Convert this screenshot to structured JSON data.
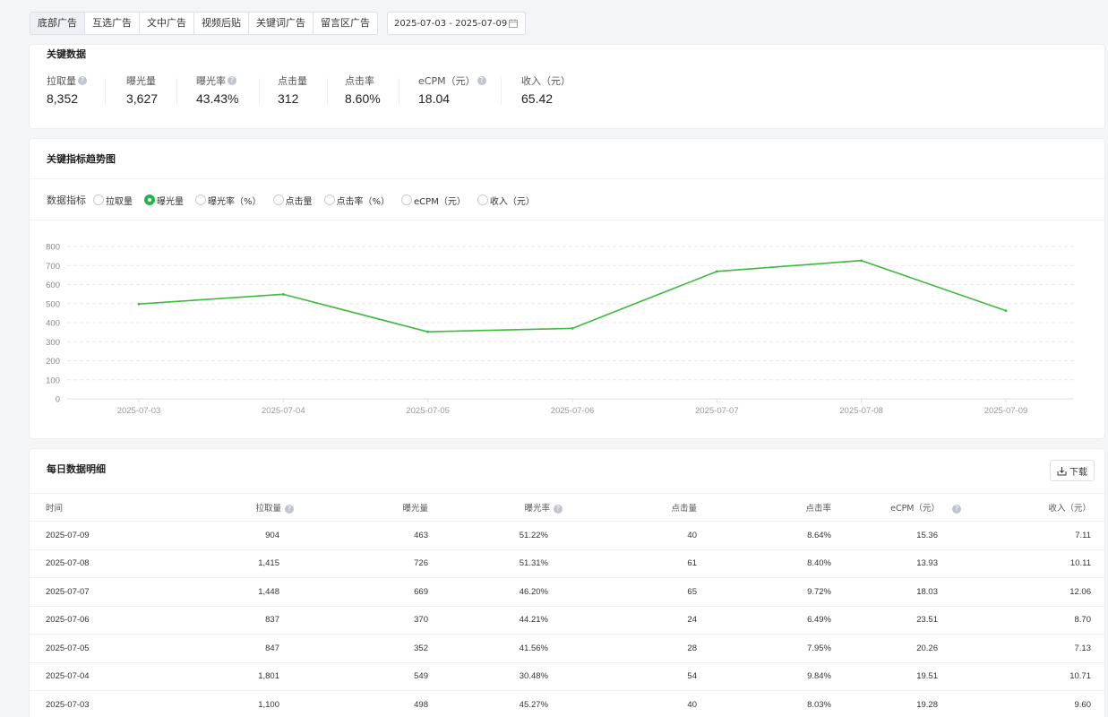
{
  "tabs": [
    {
      "label": "底部广告",
      "active": true
    },
    {
      "label": "互选广告",
      "active": false
    },
    {
      "label": "文中广告",
      "active": false
    },
    {
      "label": "视频后贴",
      "active": false
    },
    {
      "label": "关键词广告",
      "active": false
    },
    {
      "label": "留言区广告",
      "active": false
    }
  ],
  "date_range": "2025-07-03 - 2025-07-09",
  "key_data": {
    "title": "关键数据",
    "metrics": [
      {
        "label": "拉取量",
        "value": "8,352",
        "help": true
      },
      {
        "label": "曝光量",
        "value": "3,627",
        "help": false
      },
      {
        "label": "曝光率",
        "value": "43.43%",
        "help": true
      },
      {
        "label": "点击量",
        "value": "312",
        "help": false
      },
      {
        "label": "点击率",
        "value": "8.60%",
        "help": false
      },
      {
        "label": "eCPM（元）",
        "value": "18.04",
        "help": true
      },
      {
        "label": "收入（元）",
        "value": "65.42",
        "help": false
      }
    ]
  },
  "trend": {
    "title": "关键指标趋势图",
    "indicator_label": "数据指标",
    "options": [
      {
        "label": "拉取量",
        "selected": false
      },
      {
        "label": "曝光量",
        "selected": true
      },
      {
        "label": "曝光率（%）",
        "selected": false
      },
      {
        "label": "点击量",
        "selected": false
      },
      {
        "label": "点击率（%）",
        "selected": false
      },
      {
        "label": "eCPM（元）",
        "selected": false
      },
      {
        "label": "收入（元）",
        "selected": false
      }
    ]
  },
  "chart_data": {
    "type": "line",
    "x": [
      "2025-07-03",
      "2025-07-04",
      "2025-07-05",
      "2025-07-06",
      "2025-07-07",
      "2025-07-08",
      "2025-07-09"
    ],
    "series": [
      {
        "values": [
          498,
          549,
          352,
          370,
          669,
          726,
          463
        ]
      }
    ],
    "ylim": [
      0,
      800
    ],
    "yticks": [
      0,
      100,
      200,
      300,
      400,
      500,
      600,
      700,
      800
    ],
    "grid": true,
    "line_color": "#3dbb3d"
  },
  "table": {
    "title": "每日数据明细",
    "download_label": "下载",
    "columns": [
      {
        "label": "时间",
        "help": false
      },
      {
        "label": "拉取量",
        "help": true
      },
      {
        "label": "曝光量",
        "help": false
      },
      {
        "label": "曝光率",
        "help": true
      },
      {
        "label": "点击量",
        "help": false
      },
      {
        "label": "点击率",
        "help": false
      },
      {
        "label": "eCPM（元）",
        "help": true
      },
      {
        "label": "收入（元）",
        "help": false
      }
    ],
    "rows": [
      [
        "2025-07-09",
        "904",
        "463",
        "51.22%",
        "40",
        "8.64%",
        "15.36",
        "7.11"
      ],
      [
        "2025-07-08",
        "1,415",
        "726",
        "51.31%",
        "61",
        "8.40%",
        "13.93",
        "10.11"
      ],
      [
        "2025-07-07",
        "1,448",
        "669",
        "46.20%",
        "65",
        "9.72%",
        "18.03",
        "12.06"
      ],
      [
        "2025-07-06",
        "837",
        "370",
        "44.21%",
        "24",
        "6.49%",
        "23.51",
        "8.70"
      ],
      [
        "2025-07-05",
        "847",
        "352",
        "41.56%",
        "28",
        "7.95%",
        "20.26",
        "7.13"
      ],
      [
        "2025-07-04",
        "1,801",
        "549",
        "30.48%",
        "54",
        "9.84%",
        "19.51",
        "10.71"
      ],
      [
        "2025-07-03",
        "1,100",
        "498",
        "45.27%",
        "40",
        "8.03%",
        "19.28",
        "9.60"
      ]
    ]
  }
}
